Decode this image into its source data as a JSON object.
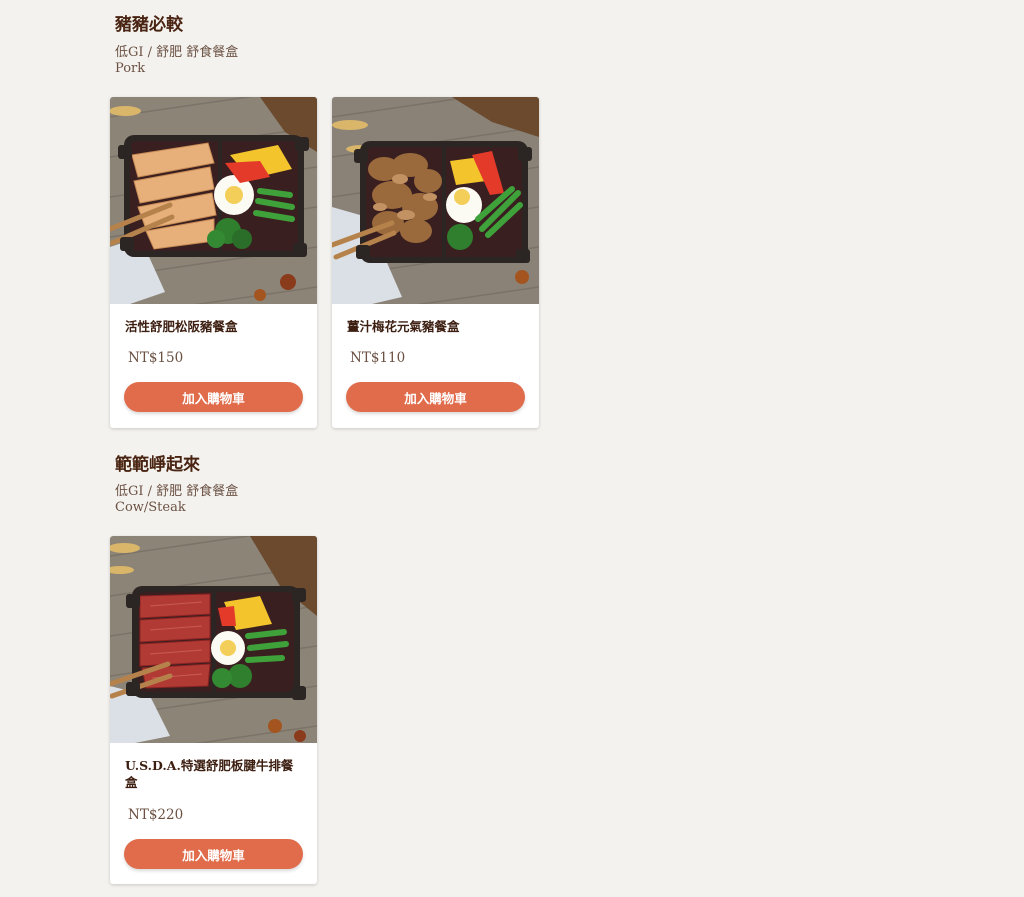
{
  "sections": [
    {
      "title": "豬豬必較",
      "subtitle": "低GI / 舒肥 舒食餐盒",
      "subtitle_en": "Pork",
      "products": [
        {
          "name": "活性舒肥松阪豬餐盒",
          "price": "NT$150",
          "button": "加入購物車",
          "meat": "pork-slices"
        },
        {
          "name": "薑汁梅花元氣豬餐盒",
          "price": "NT$110",
          "button": "加入購物車",
          "meat": "pork-stirfry"
        }
      ]
    },
    {
      "title": "範範崢起來",
      "subtitle": "低GI / 舒肥 舒食餐盒",
      "subtitle_en": "Cow/Steak",
      "products": [
        {
          "name": "U.S.D.A.特選舒肥板腱牛排餐盒",
          "price": "NT$220",
          "button": "加入購物車",
          "meat": "beef-steak"
        }
      ]
    }
  ],
  "colors": {
    "background": "#f3f2ee",
    "button": "#e06c4b",
    "title": "#4a2412"
  }
}
